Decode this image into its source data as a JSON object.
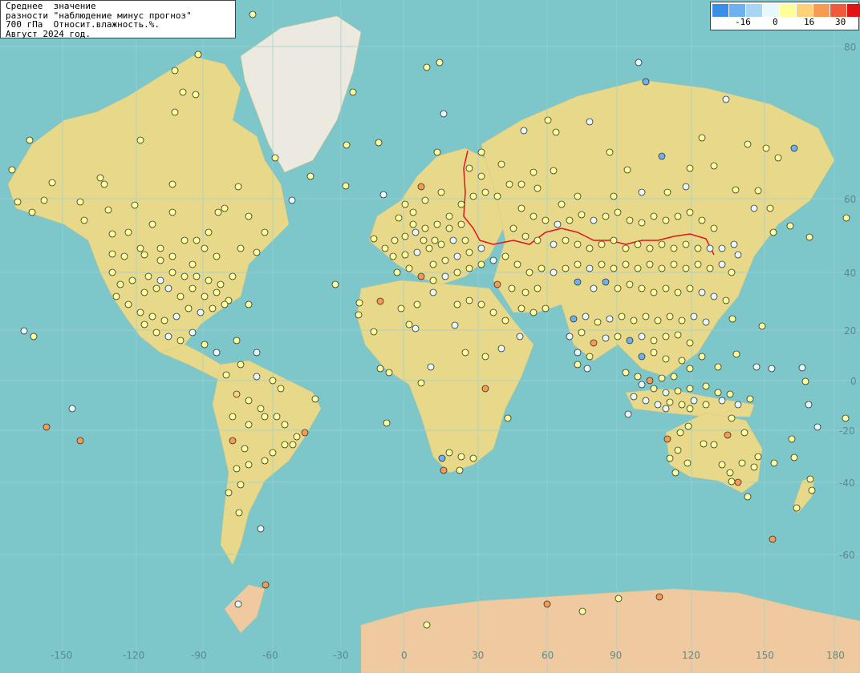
{
  "title": {
    "line1": "Среднее  значение",
    "line2": "разности \"наблюдение минус прогноз\"",
    "line3": "700 гПа  Относит.влажность.%.",
    "line4": "Август 2024 год."
  },
  "legend": {
    "colors": [
      "#3a8ee8",
      "#6db2f0",
      "#a9d5f5",
      "#e8f8ff",
      "#ffff9a",
      "#ffd27a",
      "#f99a52",
      "#f05a3a",
      "#e01414"
    ],
    "labels": [
      "-16",
      "0",
      "16",
      "30"
    ]
  },
  "axis_labels": {
    "longitude": [
      "-150",
      "-120",
      "-90",
      "-60",
      "-30",
      "0",
      "30",
      "60",
      "90",
      "120",
      "150",
      "180"
    ],
    "latitude": [
      "80",
      "60",
      "40",
      "20",
      "0",
      "-20",
      "-40",
      "-60"
    ]
  },
  "station_colors": {
    "light_blue": "#e8f8ff",
    "blue": "#6db2f0",
    "yellow": "#ffff9a",
    "light_orange": "#ffd27a",
    "orange": "#f99a52"
  },
  "icons": {
    "station": "station-marker-icon",
    "border": "russia-border-line"
  }
}
